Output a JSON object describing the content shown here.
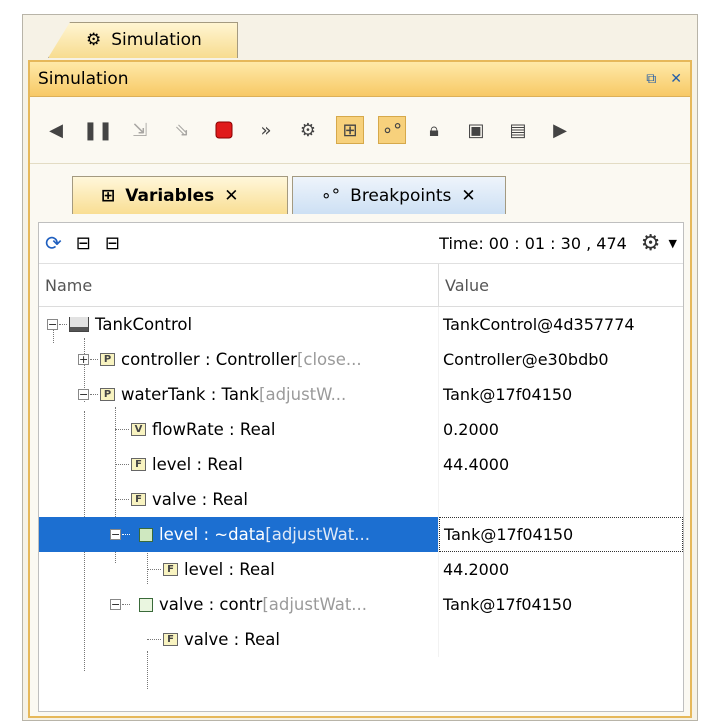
{
  "outer_tab": {
    "label": "Simulation"
  },
  "panel": {
    "title": "Simulation"
  },
  "toolbar": {
    "buttons": [
      "scroll-left-icon",
      "pause-icon",
      "step-into-icon",
      "step-over-icon",
      "terminate-icon",
      "run-to-icon",
      "animation-icon",
      "variables-view-icon",
      "breakpoints-view-icon",
      "lock-icon",
      "export-icon",
      "save-icon",
      "scroll-right-icon"
    ]
  },
  "tabs": [
    {
      "label": "Variables",
      "close": "✕",
      "icon": "variables-icon"
    },
    {
      "label": "Breakpoints",
      "close": "✕",
      "icon": "breakpoints-icon"
    }
  ],
  "time": {
    "label": "Time:",
    "value": "00 : 01 : 30 , 474"
  },
  "columns": {
    "name": "Name",
    "value": "Value"
  },
  "rows": [
    {
      "name": "TankControl",
      "extra": "",
      "value": "TankControl@4d357774"
    },
    {
      "name": "controller : Controller",
      "extra": " [close...",
      "value": "Controller@e30bdb0"
    },
    {
      "name": "waterTank : Tank",
      "extra": " [adjustW...",
      "value": "Tank@17f04150"
    },
    {
      "name": "flowRate : Real",
      "extra": "",
      "value": "0.2000"
    },
    {
      "name": "level : Real",
      "extra": "",
      "value": "44.4000"
    },
    {
      "name": "valve : Real",
      "extra": "",
      "value": ""
    },
    {
      "name": "level : ~data",
      "extra": " [adjustWat...",
      "value": "Tank@17f04150"
    },
    {
      "name": "level : Real",
      "extra": "",
      "value": "44.2000"
    },
    {
      "name": "valve : contr",
      "extra": " [adjustWat...",
      "value": "Tank@17f04150"
    },
    {
      "name": "valve : Real",
      "extra": "",
      "value": ""
    }
  ],
  "colors": {
    "selection": "#1c6fd1",
    "header_gradient_end": "#f7c966",
    "tab_active": "#f9de93"
  }
}
